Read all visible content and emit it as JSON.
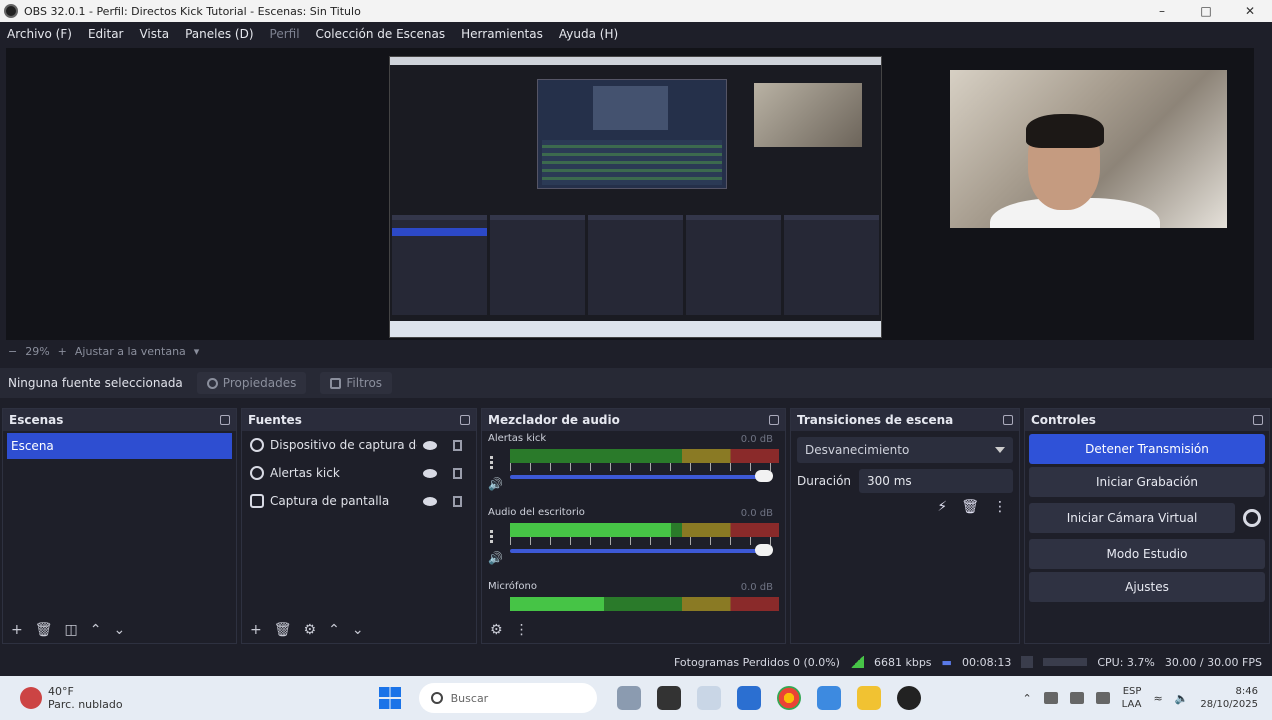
{
  "window": {
    "title": "OBS 32.0.1 - Perfil: Directos Kick Tutorial - Escenas: Sin Titulo"
  },
  "menu": [
    {
      "label": "Archivo (F)"
    },
    {
      "label": "Editar"
    },
    {
      "label": "Vista"
    },
    {
      "label": "Paneles (D)"
    },
    {
      "label": "Perfil"
    },
    {
      "label": "Colección de Escenas"
    },
    {
      "label": "Herramientas"
    },
    {
      "label": "Ayuda (H)"
    }
  ],
  "preview": {
    "zoom": "29%",
    "zoom_mode": "Ajustar a la ventana"
  },
  "context_bar": {
    "no_source": "Ninguna fuente seleccionada",
    "properties": "Propiedades",
    "filters": "Filtros"
  },
  "scenes": {
    "title": "Escenas",
    "items": [
      {
        "label": "Escena"
      }
    ]
  },
  "sources": {
    "title": "Fuentes",
    "items": [
      {
        "label": "Dispositivo de captura de v",
        "icon": "camera-icon"
      },
      {
        "label": "Alertas kick",
        "icon": "globe-icon"
      },
      {
        "label": "Captura de pantalla",
        "icon": "monitor-icon"
      }
    ]
  },
  "mixer": {
    "title": "Mezclador de audio",
    "channels": [
      {
        "name": "Alertas kick",
        "db": "0.0 dB",
        "level": 0.0
      },
      {
        "name": "Audio del escritorio",
        "db": "0.0 dB",
        "level": 0.6
      },
      {
        "name": "Micrófono",
        "db": "0.0 dB",
        "level": 0.35
      }
    ]
  },
  "transitions": {
    "title": "Transiciones de escena",
    "type": "Desvanecimiento",
    "duration_label": "Duración",
    "duration_value": "300 ms"
  },
  "controls": {
    "title": "Controles",
    "stop_stream": "Detener Transmisión",
    "start_recording": "Iniciar Grabación",
    "virtual_camera": "Iniciar Cámara Virtual",
    "studio_mode": "Modo Estudio",
    "settings": "Ajustes"
  },
  "status": {
    "dropped": "Fotogramas Perdidos 0 (0.0%)",
    "bitrate": "6681 kbps",
    "time": "00:08:13",
    "cpu": "CPU: 3.7%",
    "fps": "30.00 / 30.00 FPS"
  },
  "taskbar": {
    "weather_temp": "40°F",
    "weather_desc": "Parc. nublado",
    "search_placeholder": "Buscar",
    "lang_1": "ESP",
    "lang_2": "LAA",
    "time": "8:46",
    "date": "28/10/2025"
  },
  "colors": {
    "accent": "#2f52d8",
    "bg": "#1e1f29",
    "panel": "#2a2c3b"
  }
}
